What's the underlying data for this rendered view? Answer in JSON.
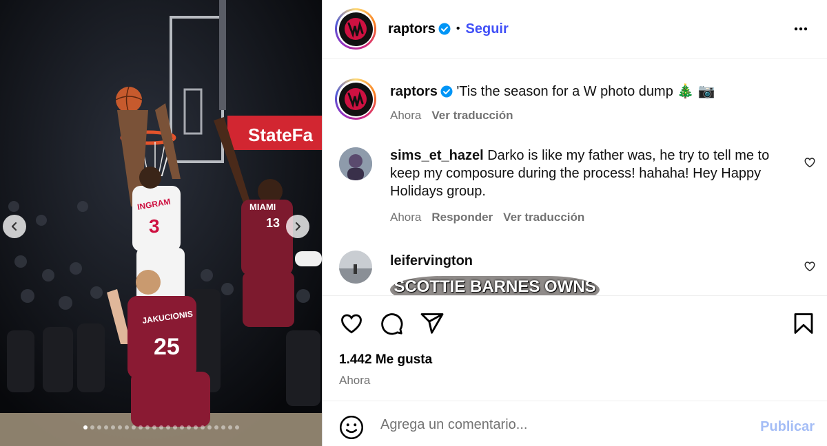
{
  "post": {
    "author": "raptors",
    "follow_label": "Seguir",
    "dot": "•"
  },
  "caption": {
    "username": "raptors",
    "text": "'Tis the season for a W photo dump 🎄 📷",
    "time": "Ahora",
    "translate": "Ver traducción"
  },
  "comments": [
    {
      "username": "sims_et_hazel",
      "text": "Darko is like my father was, he try to tell me to keep my composure during the process! hahaha! Hey Happy Holidays group.",
      "time": "Ahora",
      "reply": "Responder",
      "translate": "Ver traducción"
    },
    {
      "username": "leifervington",
      "image_text": "SCOTTIE BARNES OWNS"
    }
  ],
  "photo": {
    "banner_text": "StateFa",
    "players": [
      {
        "name": "INGRAM",
        "number": "3"
      },
      {
        "name": "MIAMI",
        "number": "13"
      },
      {
        "name": "JAKUCIONIS",
        "number": "25"
      }
    ]
  },
  "stats": {
    "likes": "1.442 Me gusta",
    "time": "Ahora"
  },
  "composer": {
    "placeholder": "Agrega un comentario...",
    "post_label": "Publicar"
  },
  "colors": {
    "accent": "#4150f7",
    "publish_disabled": "#a4bdf6",
    "raptors_red": "#ce1141",
    "heat_red": "#98002e"
  },
  "icons": [
    "chevron-left-icon",
    "chevron-right-icon",
    "verified-icon",
    "more-icon",
    "heart-icon",
    "comment-icon",
    "share-icon",
    "bookmark-icon",
    "emoji-icon"
  ]
}
